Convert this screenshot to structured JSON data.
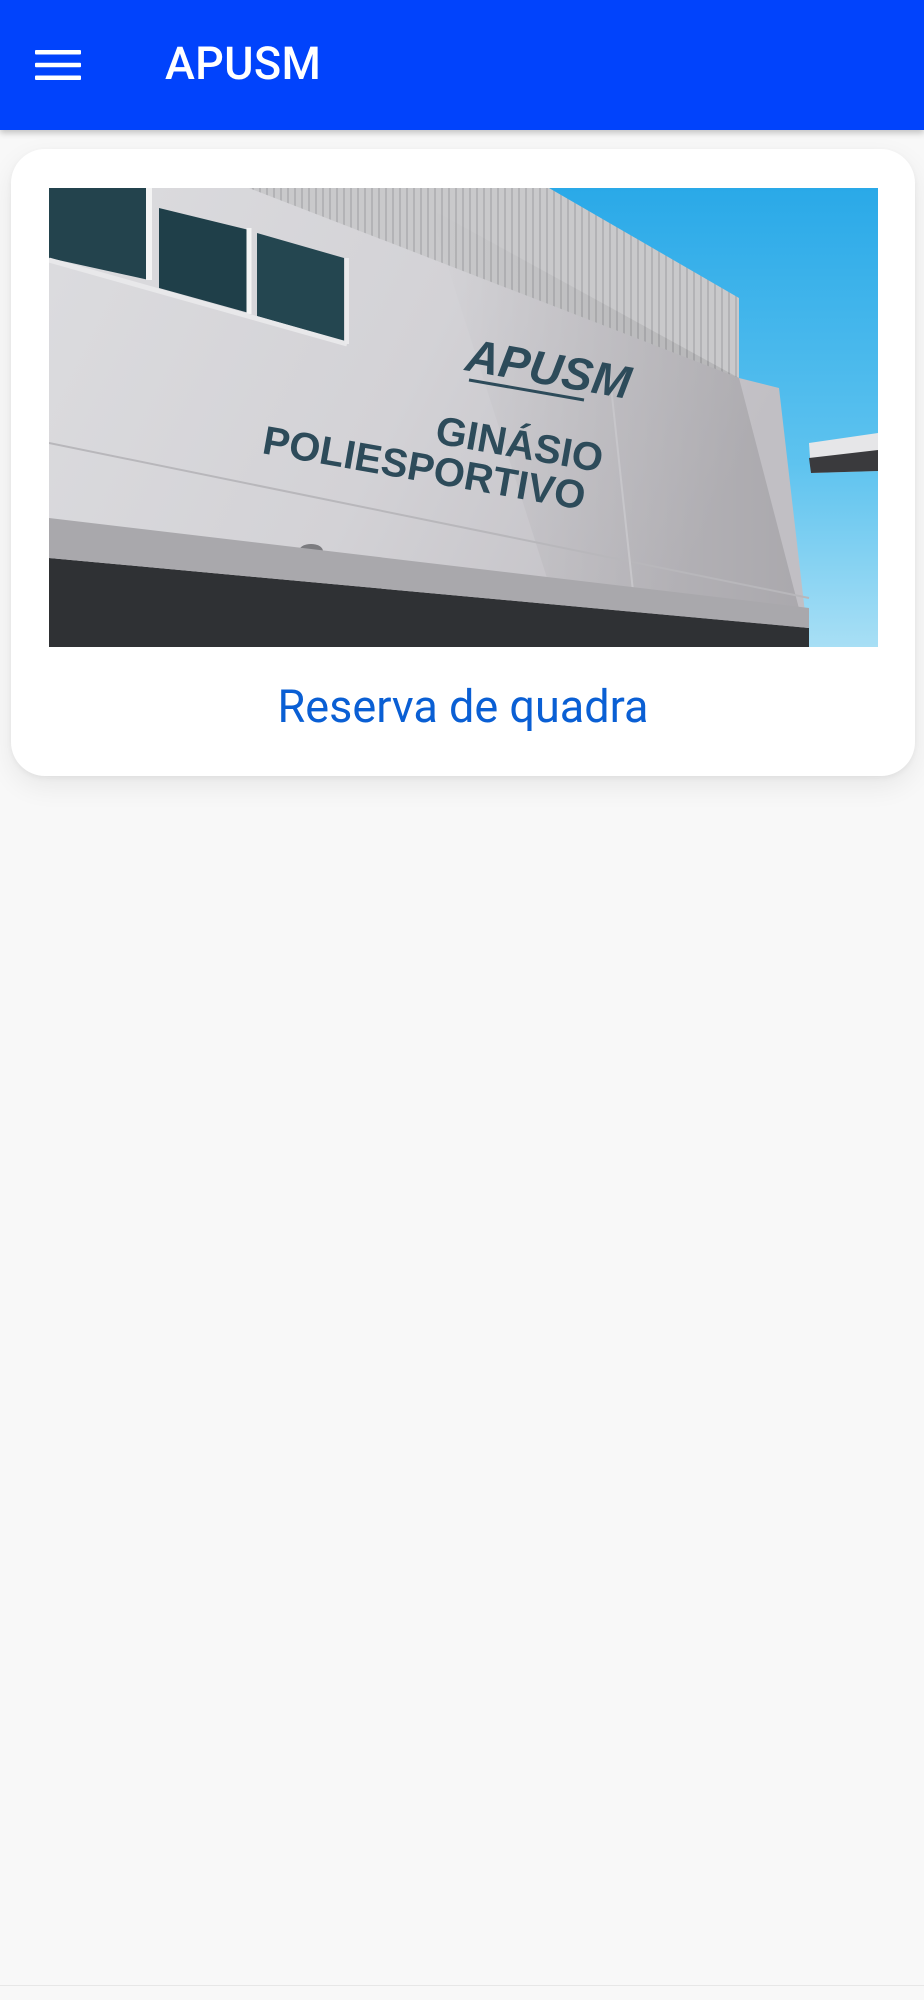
{
  "appbar": {
    "title": "APUSM",
    "menu_icon": "menu-icon",
    "background_color": "#0143fc"
  },
  "card": {
    "label": "Reserva de quadra",
    "label_color": "#0a5fd4",
    "image": {
      "sign_logo": "APUSM",
      "sign_line1": "GINÁSIO",
      "sign_line2": "POLIESPORTIVO"
    }
  },
  "colors": {
    "background": "#f8f8f8",
    "card": "#ffffff"
  }
}
